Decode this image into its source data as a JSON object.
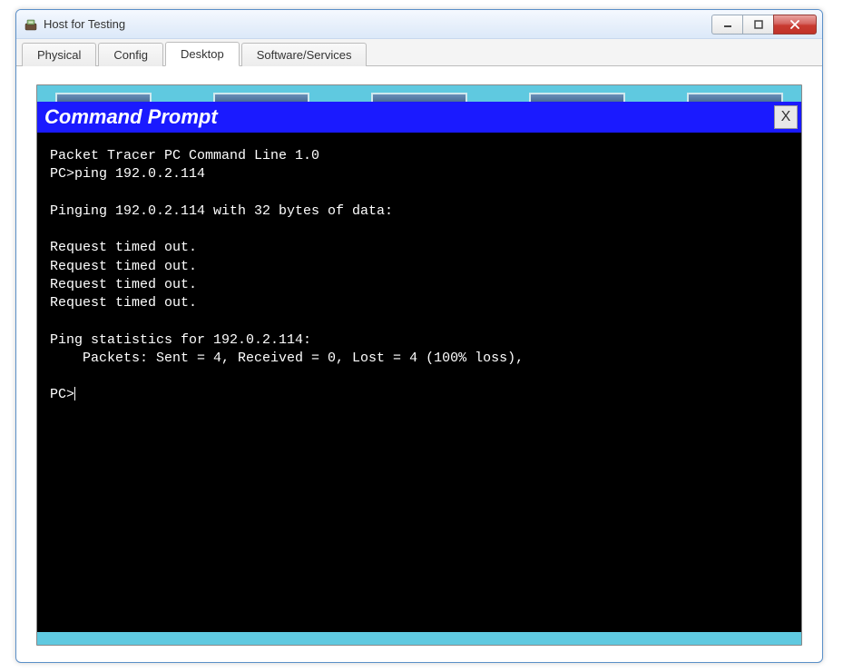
{
  "window": {
    "title": "Host for Testing"
  },
  "tabs": [
    {
      "label": "Physical",
      "active": false
    },
    {
      "label": "Config",
      "active": false
    },
    {
      "label": "Desktop",
      "active": true
    },
    {
      "label": "Software/Services",
      "active": false
    }
  ],
  "command_prompt": {
    "title": "Command Prompt",
    "close_label": "X",
    "lines": [
      "Packet Tracer PC Command Line 1.0",
      "PC>ping 192.0.2.114",
      "",
      "Pinging 192.0.2.114 with 32 bytes of data:",
      "",
      "Request timed out.",
      "Request timed out.",
      "Request timed out.",
      "Request timed out.",
      "",
      "Ping statistics for 192.0.2.114:",
      "    Packets: Sent = 4, Received = 0, Lost = 4 (100% loss),",
      "",
      "PC>"
    ]
  }
}
